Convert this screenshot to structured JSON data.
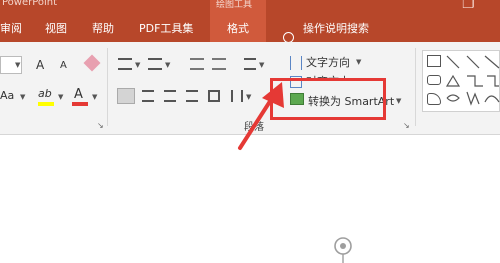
{
  "window": {
    "app_title": "PowerPoint",
    "context_tab_title": "绘图工具"
  },
  "tabs": [
    {
      "label": "审阅"
    },
    {
      "label": "视图"
    },
    {
      "label": "帮助"
    },
    {
      "label": "PDF工具集"
    },
    {
      "label": "格式"
    },
    {
      "label": "操作说明搜索"
    }
  ],
  "paragraph_group": {
    "name": "段落",
    "font_size_aa": "Aa",
    "grow_font": "A",
    "shrink_font": "A",
    "font_color_label": "A",
    "highlight_label": "ab"
  },
  "text_commands": {
    "text_direction": "文字方向",
    "align_text": "对齐文本",
    "convert_smartart": "转换为 SmartArt"
  },
  "annotation": {
    "box_color": "#e53935",
    "arrow_color": "#e53935"
  },
  "colors": {
    "accent": "#b7472a",
    "active_tab": "#d05a3c",
    "ribbon_bg": "#f3f3f3"
  }
}
